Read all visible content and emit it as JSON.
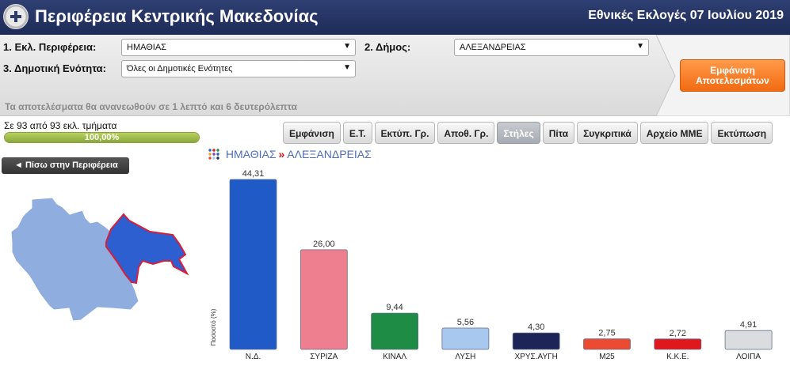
{
  "header": {
    "title": "Περιφέρεια Κεντρικής Μακεδονίας",
    "election": "Εθνικές Εκλογές 07 Ιουλίου 2019"
  },
  "filters": {
    "region_label": "1. Εκλ. Περιφέρεια:",
    "region_value": "ΗΜΑΘΙΑΣ",
    "municipality_label": "2. Δήμος:",
    "municipality_value": "ΑΛΕΞΑΝΔΡΕΙΑΣ",
    "unit_label": "3. Δημοτική Ενότητα:",
    "unit_value": "Όλες οι Δημοτικές Ενότητες",
    "show_button": [
      "Εμφάνιση",
      "Αποτελεσμάτων"
    ],
    "refresh_text": "Τα αποτελέσματα θα ανανεωθούν σε 1 λεπτό και 6 δευτερόλεπτα"
  },
  "status": {
    "count_text": "Σε 93 από 93 εκλ. τμήματα",
    "progress_label": "100,00%",
    "progress_fraction": 1.0
  },
  "toolbar": {
    "tabs": [
      "Εμφάνιση",
      "Ε.Τ.",
      "Εκτύπ. Γρ.",
      "Αποθ. Γρ.",
      "Στήλες",
      "Πίτα",
      "Συγκριτικά",
      "Αρχείο ΜΜΕ",
      "Εκτύπωση"
    ],
    "active": "Στήλες"
  },
  "back_label": "◄ Πίσω στην Περιφέρεια",
  "breadcrumb": {
    "region": "ΗΜΑΘΙΑΣ",
    "separator": "»",
    "municipality": "ΑΛΕΞΑΝΔΡΕΙΑΣ"
  },
  "map": {
    "region_fill": "#8fadde",
    "selected_fill": "#2d5fd0",
    "selected_outline": "#d81e3a"
  },
  "chart_data": {
    "type": "bar",
    "ylabel": "Ποσοστό (%)",
    "ylim": [
      0,
      44.31
    ],
    "categories": [
      "Ν.Δ.",
      "ΣΥΡΙΖΑ",
      "ΚΙΝΑΛ",
      "ΛΥΣΗ",
      "ΧΡΥΣ.ΑΥΓΗ",
      "Μ25",
      "Κ.Κ.Ε.",
      "ΛΟΙΠΑ"
    ],
    "values": [
      44.31,
      26.0,
      9.44,
      5.56,
      4.3,
      2.75,
      2.72,
      4.91
    ],
    "labels": [
      "44,31",
      "26,00",
      "9,44",
      "5,56",
      "4,30",
      "2,75",
      "2,72",
      "4,91"
    ],
    "colors": [
      "#1f5ac7",
      "#ee7f8e",
      "#1f8c45",
      "#a8c8ef",
      "#1c2458",
      "#ec4b31",
      "#e0171d",
      "#dadcdf"
    ],
    "grid": false,
    "legend": "none"
  }
}
